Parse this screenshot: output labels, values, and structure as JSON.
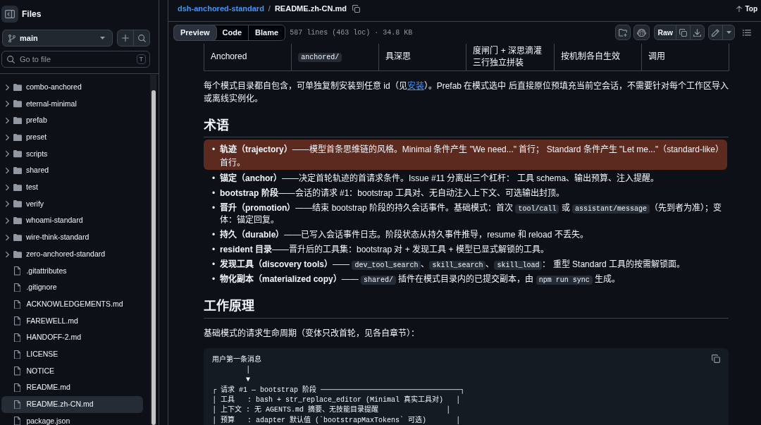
{
  "sidebar": {
    "title": "Files",
    "branch": "main",
    "go_to_file": {
      "placeholder": "Go to file",
      "shortcut": "T"
    },
    "tree": [
      {
        "kind": "folder",
        "name": "combo-anchored",
        "expanded": false,
        "selected": false
      },
      {
        "kind": "folder",
        "name": "eternal-minimal",
        "expanded": false,
        "selected": false
      },
      {
        "kind": "folder",
        "name": "prefab",
        "expanded": false,
        "selected": false
      },
      {
        "kind": "folder",
        "name": "preset",
        "expanded": false,
        "selected": false
      },
      {
        "kind": "folder",
        "name": "scripts",
        "expanded": false,
        "selected": false
      },
      {
        "kind": "folder",
        "name": "shared",
        "expanded": false,
        "selected": false
      },
      {
        "kind": "folder",
        "name": "test",
        "expanded": false,
        "selected": false
      },
      {
        "kind": "folder",
        "name": "verify",
        "expanded": false,
        "selected": false
      },
      {
        "kind": "folder",
        "name": "whoami-standard",
        "expanded": false,
        "selected": false
      },
      {
        "kind": "folder",
        "name": "wire-think-standard",
        "expanded": false,
        "selected": false
      },
      {
        "kind": "folder",
        "name": "zero-anchored-standard",
        "expanded": false,
        "selected": false
      },
      {
        "kind": "file",
        "name": ".gitattributes",
        "selected": false
      },
      {
        "kind": "file",
        "name": ".gitignore",
        "selected": false
      },
      {
        "kind": "file",
        "name": "ACKNOWLEDGEMENTS.md",
        "selected": false
      },
      {
        "kind": "file",
        "name": "FAREWELL.md",
        "selected": false
      },
      {
        "kind": "file",
        "name": "HANDOFF-2.md",
        "selected": false
      },
      {
        "kind": "file",
        "name": "LICENSE",
        "selected": false
      },
      {
        "kind": "file",
        "name": "NOTICE",
        "selected": false
      },
      {
        "kind": "file",
        "name": "README.md",
        "selected": false
      },
      {
        "kind": "file",
        "name": "README.zh-CN.md",
        "selected": true
      },
      {
        "kind": "file",
        "name": "package.json",
        "selected": false
      }
    ]
  },
  "header": {
    "repo": "dsh-anchored-standard",
    "separator": "/",
    "file": "README.zh-CN.md",
    "top_link": "Top"
  },
  "toolbar": {
    "tabs": [
      {
        "label": "Preview",
        "selected": true
      },
      {
        "label": "Code",
        "selected": false
      },
      {
        "label": "Blame",
        "selected": false
      }
    ],
    "file_info": "587 lines (463 loc) · 34.8 KB",
    "raw_button": "Raw"
  },
  "table": {
    "rows": [
      {
        "cells": [
          {
            "kind": "text",
            "lines": [
              "Anchored"
            ]
          },
          {
            "kind": "code",
            "lines": [
              "anchored/"
            ]
          },
          {
            "kind": "text",
            "lines": [
              "具深思"
            ]
          },
          {
            "kind": "text",
            "lines": [
              "度闸门 + 深思滴灌",
              "三行独立拼装"
            ]
          },
          {
            "kind": "text",
            "lines": [
              "按机制各自生效"
            ]
          },
          {
            "kind": "text",
            "lines": [
              "调用"
            ]
          }
        ]
      }
    ]
  },
  "intro": {
    "parts": [
      {
        "kind": "text",
        "text": "每个模式目录都自包含，可单独复制安装到任意 id（见"
      },
      {
        "kind": "link",
        "text": "安装"
      },
      {
        "kind": "text",
        "text": "）。Prefab 在模式选中 后直接原位预填充当前空会话，不需要针对每个工作区导入或离线实例化。"
      }
    ]
  },
  "sections": [
    {
      "heading": "术语",
      "list": {
        "marker": "•",
        "items": [
          {
            "highlighted": true,
            "parts": [
              {
                "kind": "term",
                "text": "轨迹（trajectory）"
              },
              {
                "kind": "text",
                "text": "——模型首条思维链的风格。Minimal 条件产生 \"We need...\" 首行； Standard 条件产生 \"Let me...\"（standard-like）首行。"
              }
            ]
          },
          {
            "highlighted": false,
            "parts": [
              {
                "kind": "term",
                "text": "锚定（anchor）"
              },
              {
                "kind": "text",
                "text": "——决定首轮轨迹的首请求条件。Issue #11 分离出三个杠杆： 工具 schema、输出预算、注入提醒。"
              }
            ]
          },
          {
            "highlighted": false,
            "parts": [
              {
                "kind": "term",
                "text": "bootstrap 阶段"
              },
              {
                "kind": "text",
                "text": "——会话的请求 #1：bootstrap 工具对、无自动注入上下文、可选输出封顶。"
              }
            ]
          },
          {
            "highlighted": false,
            "parts": [
              {
                "kind": "term",
                "text": "晋升（promotion）"
              },
              {
                "kind": "text",
                "text": "——结束 bootstrap 阶段的持久会话事件。基础模式：首次 "
              },
              {
                "kind": "code",
                "text": "tool/call"
              },
              {
                "kind": "text",
                "text": " 或 "
              },
              {
                "kind": "code",
                "text": "assistant/message"
              },
              {
                "kind": "text",
                "text": "（先到者为准）；变体：锚定回复。"
              }
            ]
          },
          {
            "highlighted": false,
            "parts": [
              {
                "kind": "term",
                "text": "持久（durable）"
              },
              {
                "kind": "text",
                "text": "——已写入会话事件日志。阶段状态从持久事件推导，resume 和 reload 不丢失。"
              }
            ]
          },
          {
            "highlighted": false,
            "parts": [
              {
                "kind": "term",
                "text": "resident 目录"
              },
              {
                "kind": "text",
                "text": "——晋升后的工具集：bootstrap 对 + 发现工具 + 模型已显式解锁的工具。"
              }
            ]
          },
          {
            "highlighted": false,
            "parts": [
              {
                "kind": "term",
                "text": "发现工具（discovery tools）"
              },
              {
                "kind": "text",
                "text": "—— "
              },
              {
                "kind": "code",
                "text": "dev_tool_search"
              },
              {
                "kind": "text",
                "text": "、"
              },
              {
                "kind": "code",
                "text": "skill_search"
              },
              {
                "kind": "text",
                "text": "、"
              },
              {
                "kind": "code",
                "text": "skill_load"
              },
              {
                "kind": "text",
                "text": "： 重型 Standard 工具的按需解锁面。"
              }
            ]
          },
          {
            "highlighted": false,
            "parts": [
              {
                "kind": "term",
                "text": "物化副本（materialized copy）"
              },
              {
                "kind": "text",
                "text": "—— "
              },
              {
                "kind": "code",
                "text": "shared/"
              },
              {
                "kind": "text",
                "text": " 插件在模式目录内的已提交副本，由 "
              },
              {
                "kind": "code",
                "text": "npm run sync"
              },
              {
                "kind": "text",
                "text": " 生成。"
              }
            ]
          }
        ]
      }
    },
    {
      "heading": "工作原理",
      "paragraph": "基础模式的请求生命周期（变体只改首轮，见各自章节）：",
      "code_block": {
        "lines": [
          "用户第一条消息",
          "        │",
          "        ▼",
          "┌ 请求 #1 — bootstrap 阶段 ─────────────────────────────────┐",
          "│ 工具   : bash + str_replace_editor (Minimal 真实工具对)   │",
          "│ 上下文 : 无 AGENTS.md 摘要、无技能目录提醒                │",
          "│ 预算   : adapter 默认值 (`bootstrapMaxTokens` 可选)       │"
        ]
      }
    }
  ]
}
